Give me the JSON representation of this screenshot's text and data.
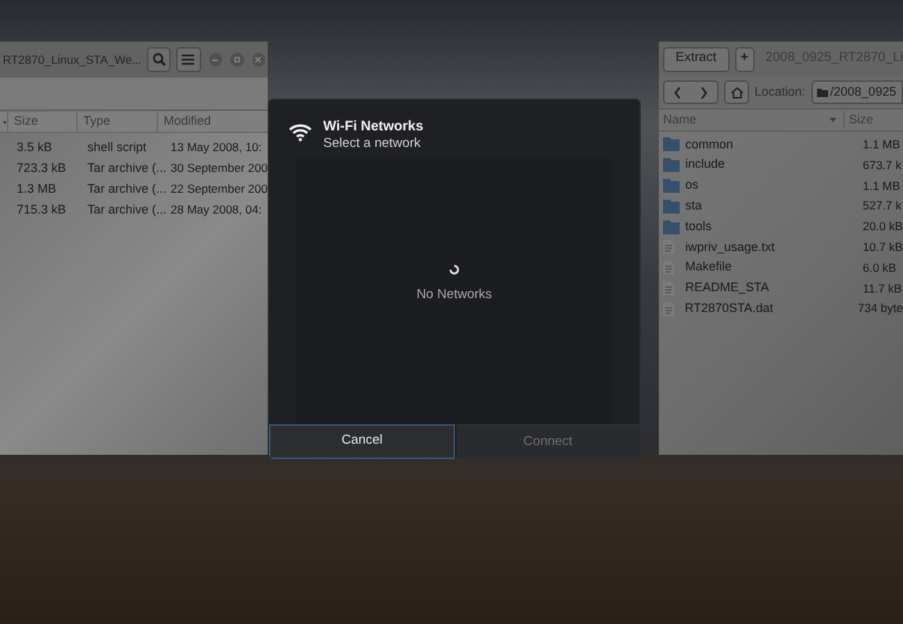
{
  "left_window": {
    "title": "RT2870_Linux_STA_We...",
    "columns": [
      "Size",
      "Type",
      "Modified"
    ],
    "rows": [
      {
        "size": "3.5 kB",
        "type": "shell script",
        "modified": "13 May 2008, 10:"
      },
      {
        "size": "723.3 kB",
        "type": "Tar archive (...",
        "modified": "30 September 200"
      },
      {
        "size": "1.3 MB",
        "type": "Tar archive (...",
        "modified": "22 September 200"
      },
      {
        "size": "715.3 kB",
        "type": "Tar archive (...",
        "modified": "28 May 2008, 04:"
      }
    ]
  },
  "right_window": {
    "buttons": [
      "Extract",
      "+"
    ],
    "title": "2008_0925_RT2870_Li",
    "location_label": "Location:",
    "location": "/2008_0925",
    "columns": [
      "Name",
      "Size"
    ],
    "rows": [
      {
        "kind": "folder",
        "name": "common",
        "size": "1.1 MB"
      },
      {
        "kind": "folder",
        "name": "include",
        "size": "673.7 k"
      },
      {
        "kind": "folder",
        "name": "os",
        "size": "1.1 MB"
      },
      {
        "kind": "folder",
        "name": "sta",
        "size": "527.7 k"
      },
      {
        "kind": "folder",
        "name": "tools",
        "size": "20.0 kB"
      },
      {
        "kind": "file",
        "name": "iwpriv_usage.txt",
        "size": "10.7 kB"
      },
      {
        "kind": "file",
        "name": "Makefile",
        "size": "6.0 kB"
      },
      {
        "kind": "file",
        "name": "README_STA",
        "size": "11.7 kB"
      },
      {
        "kind": "file",
        "name": "RT2870STA.dat",
        "size": "734 byte"
      }
    ]
  },
  "dialog": {
    "title": "Wi-Fi Networks",
    "subtitle": "Select a network",
    "status": "No Networks",
    "buttons": [
      {
        "label": "Cancel",
        "selected": true,
        "disabled": false
      },
      {
        "label": "Connect",
        "selected": false,
        "disabled": true
      }
    ]
  }
}
